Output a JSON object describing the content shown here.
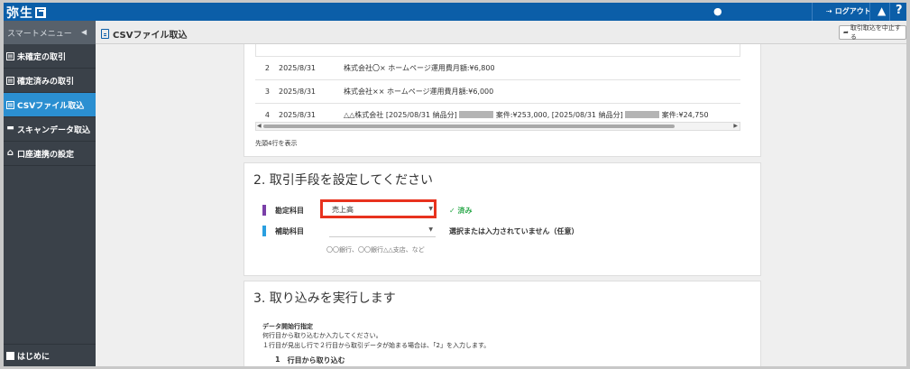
{
  "app": {
    "logo": "弥生"
  },
  "header": {
    "logout": "ログアウト",
    "help": "?"
  },
  "subheader": {
    "smart_menu": "スマートメニュー",
    "collapse": "◀",
    "page_title": "CSVファイル取込",
    "cancel_button": "取引取込を中止する"
  },
  "sidebar": {
    "items": [
      {
        "label": "未確定の取引",
        "icon": "▤"
      },
      {
        "label": "確定済みの取引",
        "icon": "▤"
      },
      {
        "label": "CSVファイル取込",
        "icon": "▤"
      },
      {
        "label": "スキャンデータ取込",
        "icon": "▬"
      },
      {
        "label": "口座連携の設定",
        "icon": "⌂"
      }
    ],
    "active_index": 2,
    "bottom": "はじめに"
  },
  "preview": {
    "rows": [
      {
        "no": "2",
        "date": "2025/8/31",
        "desc": "株式会社〇× ホームページ運用費月額:¥6,800"
      },
      {
        "no": "3",
        "date": "2025/8/31",
        "desc": "株式会社×× ホームページ運用費月額:¥6,000"
      },
      {
        "no": "4",
        "date": "2025/8/31",
        "desc_a": "△△株式会社 [2025/08/31 納品分]",
        "desc_b": "案件:¥253,000, [2025/08/31 納品分]",
        "desc_c": "案件:¥24,750"
      }
    ],
    "note": "先頭4行を表示"
  },
  "section2": {
    "title": "2. 取引手段を設定してください",
    "account_label": "勘定科目",
    "account_value": "売上高",
    "account_status": "✓ 済み",
    "sub_label": "補助科目",
    "sub_value": "",
    "sub_status": "選択または入力されていません（任意）",
    "hint": "〇〇銀行、〇〇銀行△△支店、など",
    "colors": {
      "account_bar": "#7a3fa8",
      "sub_bar": "#2a9fe0",
      "highlight": "#e8321e"
    }
  },
  "section3": {
    "title": "3. 取り込みを実行します",
    "start_heading": "データ開始行指定",
    "desc1": "何行目から取り込むか入力してください。",
    "desc2": "１行目が見出し行で２行目から取引データが始まる場合は、「2」を入力します。",
    "start_value": "1",
    "start_suffix": "行目から取り込む"
  }
}
